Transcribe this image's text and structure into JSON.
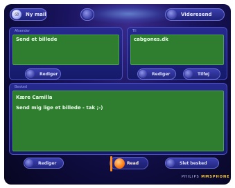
{
  "header": {
    "inbox_label": "Ny mail",
    "title_label": "",
    "forward_label": "Videresend"
  },
  "from_panel": {
    "label": "Afsender",
    "value": "Send et billede"
  },
  "to_panel": {
    "label": "Til",
    "value": "cabgones.dk"
  },
  "from_buttons": {
    "edit_label": "Rediger"
  },
  "to_buttons": {
    "edit_label": "Rediger",
    "extra_label": "Tilføj"
  },
  "message_panel": {
    "label": "Besked",
    "lines": [
      "Kære Camilla",
      "Send mig lige et billede - tak ;-)"
    ]
  },
  "bottom_bar": {
    "edit_label": "Rediger",
    "read_label": "Read",
    "end_label": "Slet besked"
  },
  "footer": {
    "brand_left": "PHILIPS",
    "brand_right": "MMSPHONE"
  },
  "colors": {
    "background": "#0d0b3a",
    "panel": "#262a8f",
    "field_green": "#2f7d2f",
    "accent_orange": "#ff8a1a"
  }
}
